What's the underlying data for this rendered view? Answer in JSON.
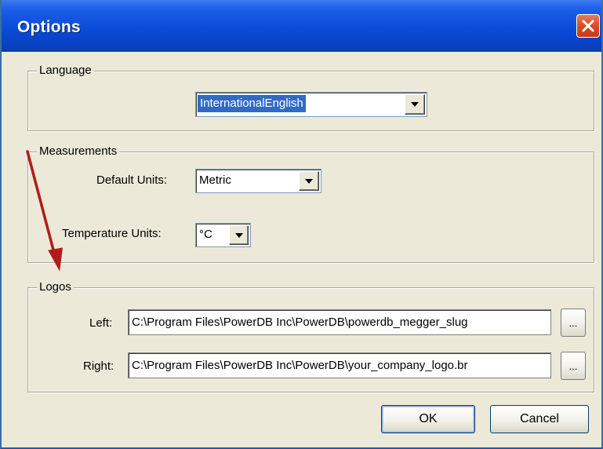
{
  "window": {
    "title": "Options",
    "close_icon": "close-x-icon"
  },
  "language": {
    "group_label": "Language",
    "selected": "InternationalEnglish"
  },
  "measurements": {
    "group_label": "Measurements",
    "default_units_label": "Default Units:",
    "default_units_value": "Metric",
    "temperature_units_label": "Temperature Units:",
    "temperature_units_value": "°C"
  },
  "logos": {
    "group_label": "Logos",
    "left_label": "Left:",
    "left_path": "C:\\Program Files\\PowerDB Inc\\PowerDB\\powerdb_megger_slug",
    "right_label": "Right:",
    "right_path": "C:\\Program Files\\PowerDB Inc\\PowerDB\\your_company_logo.br",
    "browse_label": "..."
  },
  "buttons": {
    "ok": "OK",
    "cancel": "Cancel"
  },
  "colors": {
    "annotation_arrow": "#b01c1c",
    "title_bar": "#0a4bd8",
    "selection": "#316ac5"
  }
}
